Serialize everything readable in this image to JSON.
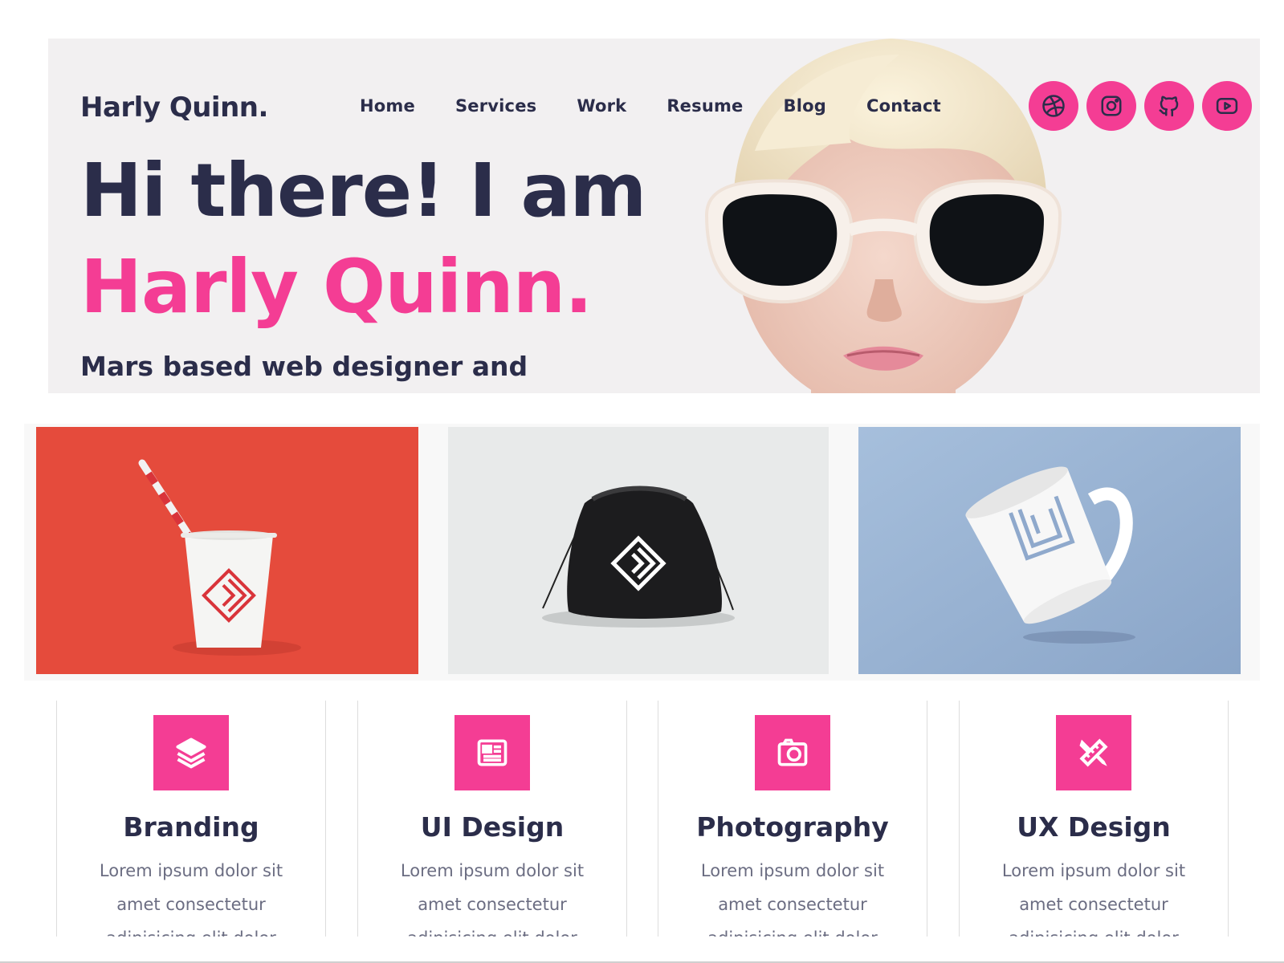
{
  "header": {
    "brand": "Harly Quinn.",
    "nav": [
      "Home",
      "Services",
      "Work",
      "Resume",
      "Blog",
      "Contact"
    ],
    "socials": [
      "dribbble-icon",
      "instagram-icon",
      "github-icon",
      "youtube-icon"
    ]
  },
  "hero": {
    "greeting": "Hi there! I am",
    "name": "Harly Quinn.",
    "tagline": "Mars based web designer and photographer."
  },
  "services": [
    {
      "icon": "layers-icon",
      "title": "Branding",
      "text": "Lorem ipsum dolor sit amet consectetur adipisicing elit dolor"
    },
    {
      "icon": "newspaper-icon",
      "title": "UI Design",
      "text": "Lorem ipsum dolor sit amet consectetur adipisicing elit dolor"
    },
    {
      "icon": "camera-icon",
      "title": "Photography",
      "text": "Lorem ipsum dolor sit amet consectetur adipisicing elit dolor"
    },
    {
      "icon": "pencil-ruler-icon",
      "title": "UX Design",
      "text": "Lorem ipsum dolor sit amet consectetur adipisicing elit dolor"
    }
  ],
  "colors": {
    "accent": "#f43d94",
    "dark": "#2b2d4a",
    "muted": "#6b6d82",
    "hero_bg": "#f2f0f1"
  }
}
